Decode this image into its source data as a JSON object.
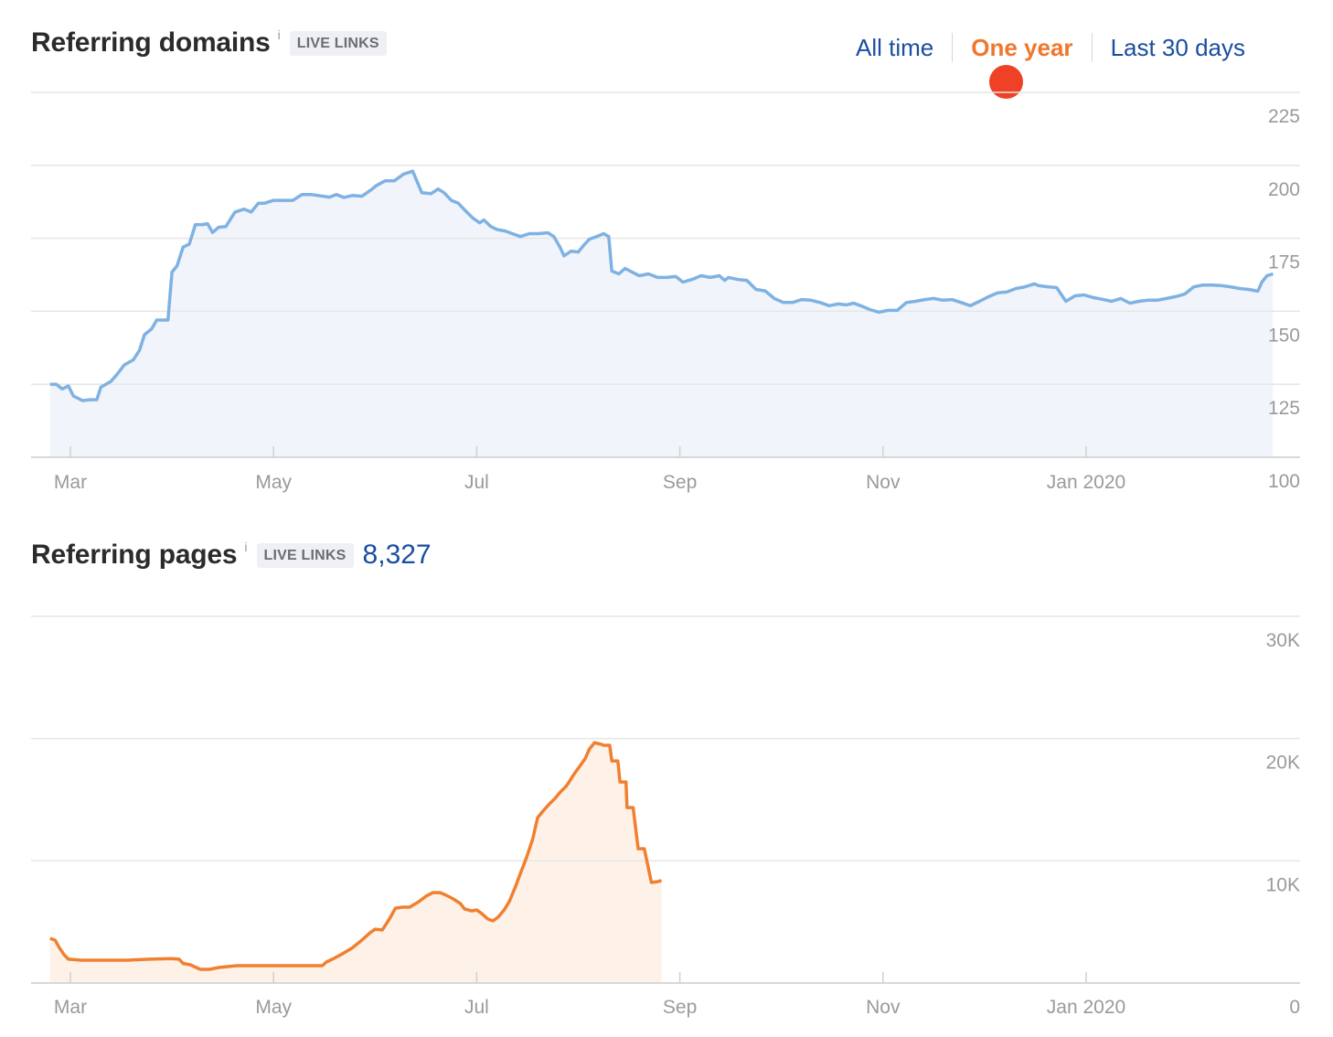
{
  "header": {
    "title": "Referring domains",
    "info_icon": "info-icon",
    "badge": "LIVE LINKS"
  },
  "range_tabs": [
    {
      "label": "All time",
      "active": false
    },
    {
      "label": "One year",
      "active": true
    },
    {
      "label": "Last 30 days",
      "active": false
    }
  ],
  "colors": {
    "link": "#1b4ea0",
    "active_tab": "#f0772c",
    "marker": "#ee4125",
    "domains_line": "#7fb2e2",
    "domains_fill": "#f1f5fb",
    "pages_line": "#f08030",
    "pages_fill": "#fdf1e8"
  },
  "section2": {
    "title": "Referring pages",
    "info_icon": "info-icon",
    "badge": "LIVE LINKS",
    "count": "8,327"
  },
  "chart_data": [
    {
      "type": "area",
      "title": "Referring domains",
      "xlabel": "",
      "ylabel": "",
      "x_ticks": [
        "Mar",
        "May",
        "Jul",
        "Sep",
        "Nov",
        "Jan 2020"
      ],
      "y_ticks": [
        "225",
        "200",
        "175",
        "150",
        "125",
        "100"
      ],
      "ylim": [
        100,
        225
      ],
      "y_axis_position": "right",
      "grid": true,
      "x_range_months": [
        -0.2,
        11.85
      ],
      "series": [
        {
          "name": "Referring domains",
          "x_months": [
            -0.2,
            -0.14,
            -0.08,
            -0.02,
            0.03,
            0.12,
            0.19,
            0.26,
            0.3,
            0.4,
            0.46,
            0.53,
            0.62,
            0.68,
            0.73,
            0.8,
            0.85,
            0.91,
            0.96,
            1.0,
            1.05,
            1.11,
            1.17,
            1.23,
            1.3,
            1.35,
            1.4,
            1.46,
            1.53,
            1.62,
            1.71,
            1.78,
            1.85,
            1.91,
            2.0,
            2.1,
            2.19,
            2.28,
            2.37,
            2.55,
            2.62,
            2.69,
            2.78,
            2.87,
            2.96,
            3.01,
            3.1,
            3.19,
            3.28,
            3.37,
            3.46,
            3.55,
            3.62,
            3.68,
            3.75,
            3.82,
            3.89,
            3.96,
            4.03,
            4.07,
            4.14,
            4.2,
            4.28,
            4.35,
            4.43,
            4.52,
            4.61,
            4.7,
            4.76,
            4.82,
            4.86,
            4.93,
            5.0,
            5.05,
            5.11,
            5.18,
            5.25,
            5.3,
            5.33,
            5.4,
            5.46,
            5.53,
            5.6,
            5.69,
            5.78,
            5.87,
            5.96,
            6.03,
            6.12,
            6.21,
            6.3,
            6.39,
            6.44,
            6.48,
            6.57,
            6.66,
            6.75,
            6.84,
            6.93,
            7.02,
            7.11,
            7.2,
            7.29,
            7.38,
            7.47,
            7.56,
            7.64,
            7.71,
            7.78,
            7.87,
            7.96,
            8.05,
            8.14,
            8.23,
            8.32,
            8.41,
            8.5,
            8.59,
            8.68,
            8.77,
            8.86,
            8.95,
            9.04,
            9.13,
            9.22,
            9.31,
            9.4,
            9.49,
            9.53,
            9.62,
            9.71,
            9.8,
            9.89,
            9.98,
            10.07,
            10.16,
            10.25,
            10.34,
            10.43,
            10.52,
            10.61,
            10.7,
            10.79,
            10.88,
            10.97,
            11.06,
            11.15,
            11.24,
            11.33,
            11.42,
            11.51,
            11.6,
            11.69,
            11.73,
            11.78,
            11.84
          ],
          "values": [
            125,
            125,
            123.4,
            124.4,
            121,
            119.4,
            119.7,
            119.7,
            124,
            126,
            128.4,
            131.6,
            133.4,
            136.6,
            142,
            144,
            147,
            147,
            147,
            163.4,
            165.6,
            172,
            173,
            179.7,
            179.7,
            180,
            177,
            178.8,
            179,
            184,
            185,
            184,
            187,
            187,
            188,
            188,
            188,
            190,
            190,
            189.1,
            190,
            189,
            189.7,
            189.4,
            191.6,
            193,
            194.7,
            194.7,
            197,
            198,
            190.6,
            190.3,
            191.9,
            190.6,
            188,
            187,
            184.4,
            182,
            180.3,
            181.3,
            179,
            178,
            177.5,
            176.6,
            175.6,
            176.6,
            176.6,
            176.9,
            175.6,
            172,
            169,
            170.6,
            170.3,
            172.5,
            174.7,
            175.6,
            176.6,
            175.6,
            163.8,
            162.8,
            164.7,
            163.4,
            162.2,
            162.8,
            161.6,
            161.6,
            161.9,
            160,
            160.9,
            162.2,
            161.6,
            162.2,
            160.6,
            161.6,
            160.9,
            160.6,
            157.5,
            157,
            154.4,
            153,
            153,
            154,
            153.8,
            153,
            151.9,
            152.5,
            152.2,
            152.8,
            151.9,
            150.6,
            149.7,
            150.3,
            150.3,
            153,
            153.4,
            154,
            154.4,
            153.8,
            154,
            153,
            151.9,
            153.4,
            155,
            156.3,
            156.6,
            157.8,
            158.4,
            159.4,
            158.8,
            158.4,
            158.1,
            153.4,
            155.3,
            155.6,
            154.7,
            154.1,
            153.4,
            154.4,
            152.8,
            153.4,
            153.8,
            153.8,
            154.4,
            155,
            155.9,
            158.4,
            159,
            159,
            158.8,
            158.4,
            157.8,
            157.5,
            156.9,
            160,
            162.2,
            162.8
          ]
        }
      ]
    },
    {
      "type": "area",
      "title": "Referring pages",
      "xlabel": "",
      "ylabel": "",
      "x_ticks": [
        "Mar",
        "May",
        "Jul",
        "Sep",
        "Nov",
        "Jan 2020"
      ],
      "y_ticks": [
        "30K",
        "20K",
        "10K",
        "0"
      ],
      "ylim": [
        0,
        30000
      ],
      "y_axis_position": "right",
      "grid": true,
      "x_range_months": [
        -0.2,
        11.82
      ],
      "series": [
        {
          "name": "Referring pages",
          "x_months": [
            -0.2,
            -0.15,
            -0.11,
            -0.06,
            -0.02,
            0.11,
            0.56,
            0.78,
            1.0,
            1.07,
            1.11,
            1.18,
            1.23,
            1.28,
            1.37,
            1.46,
            1.64,
            1.87,
            2.09,
            2.32,
            2.48,
            2.52,
            2.59,
            2.68,
            2.77,
            2.86,
            2.95,
            3.0,
            3.07,
            3.14,
            3.2,
            3.27,
            3.34,
            3.43,
            3.5,
            3.57,
            3.64,
            3.7,
            3.77,
            3.84,
            3.88,
            3.95,
            4.0,
            4.05,
            4.11,
            4.16,
            4.21,
            4.27,
            4.32,
            4.38,
            4.43,
            4.49,
            4.55,
            4.6,
            4.66,
            4.71,
            4.77,
            4.82,
            4.88,
            4.91,
            4.95,
            4.98,
            5.02,
            5.07,
            5.11,
            5.16,
            5.19,
            5.23,
            5.25,
            5.31,
            5.33,
            5.39,
            5.41,
            5.47,
            5.48,
            5.54,
            5.59,
            5.65,
            5.72,
            5.78,
            5.82
          ],
          "values": [
            3660,
            3510,
            2900,
            2300,
            1950,
            1870,
            1870,
            1950,
            2000,
            1950,
            1600,
            1500,
            1300,
            1120,
            1120,
            1270,
            1420,
            1420,
            1420,
            1420,
            1420,
            1720,
            2000,
            2400,
            2840,
            3440,
            4110,
            4410,
            4340,
            5240,
            6130,
            6210,
            6210,
            6660,
            7100,
            7400,
            7400,
            7180,
            6880,
            6500,
            6060,
            5900,
            5980,
            5680,
            5240,
            5090,
            5390,
            5980,
            6660,
            7850,
            8970,
            10250,
            11740,
            13540,
            14140,
            14600,
            15100,
            15600,
            16100,
            16450,
            16980,
            17350,
            17800,
            18400,
            19150,
            19670,
            19600,
            19520,
            19450,
            19450,
            18170,
            18170,
            16450,
            16450,
            14360,
            14360,
            10990,
            10990,
            8230,
            8300,
            8380
          ]
        }
      ]
    }
  ]
}
